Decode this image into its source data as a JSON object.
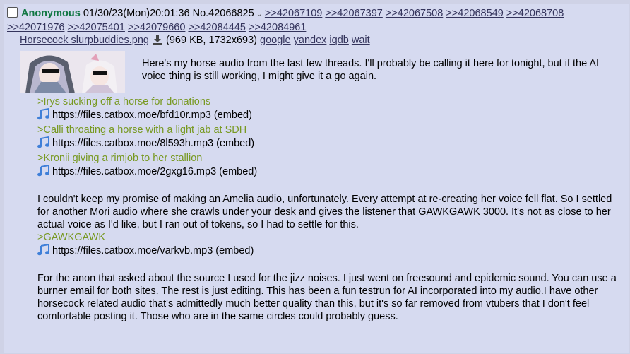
{
  "post": {
    "name": "Anonymous",
    "datetime": "01/30/23(Mon)20:01:36",
    "number": "No.42066825",
    "replies_line1": [
      ">>42067109",
      ">>42067397",
      ">>42067508",
      ">>42068549",
      ">>42068708"
    ],
    "replies_line2": [
      ">>42071976",
      ">>42075401",
      ">>42079660",
      ">>42084445",
      ">>42084961"
    ]
  },
  "file": {
    "filename": "Horsecock slurpbuddies.png",
    "meta": "(969 KB, 1732x693)",
    "search_links": [
      "google",
      "yandex",
      "iqdb",
      "wait"
    ]
  },
  "body": {
    "intro": "Here's my horse audio from the last few threads. I'll probably be calling it here for tonight, but if the AI voice thing is still working, I might give it a go again.",
    "items": [
      {
        "quote": ">Irys sucking off a horse for donations",
        "url": "https://files.catbox.moe/bfd10r.mp3",
        "embed": "(embed)"
      },
      {
        "quote": ">Calli throating a horse with a light jab at SDH",
        "url": "https://files.catbox.moe/8l593h.mp3",
        "embed": "(embed)"
      },
      {
        "quote": ">Kronii giving a rimjob to her stallion",
        "url": "https://files.catbox.moe/2gxg16.mp3",
        "embed": "(embed)"
      }
    ],
    "paragraph2": "I couldn't keep my promise of making an Amelia audio, unfortunately. Every attempt at re-creating her voice fell flat. So I settled for another Mori audio where she crawls under your desk and gives the listener that GAWKGAWK 3000. It's not as close to her actual voice as I'd like, but I ran out of tokens, so I had to settle for this.",
    "item4": {
      "quote": ">GAWKGAWK",
      "url": "https://files.catbox.moe/varkvb.mp3",
      "embed": "(embed)"
    },
    "paragraph3": "For the anon that asked about the source I used for the jizz noises. I just went on freesound and epidemic sound. You can use a burner email for both sites. The rest is just editing. This has been a fun testrun for AI incorporated into my audio.I have other horsecock related audio that's admittedly much better quality than this, but it's so far removed from vtubers that I don't feel comfortable posting it. Those who are in the same circles could probably guess."
  },
  "colors": {
    "background": "#d6daf0",
    "name": "#117743",
    "greentext": "#789922",
    "link": "#34345c",
    "music_icon": "#3f7fd8"
  }
}
